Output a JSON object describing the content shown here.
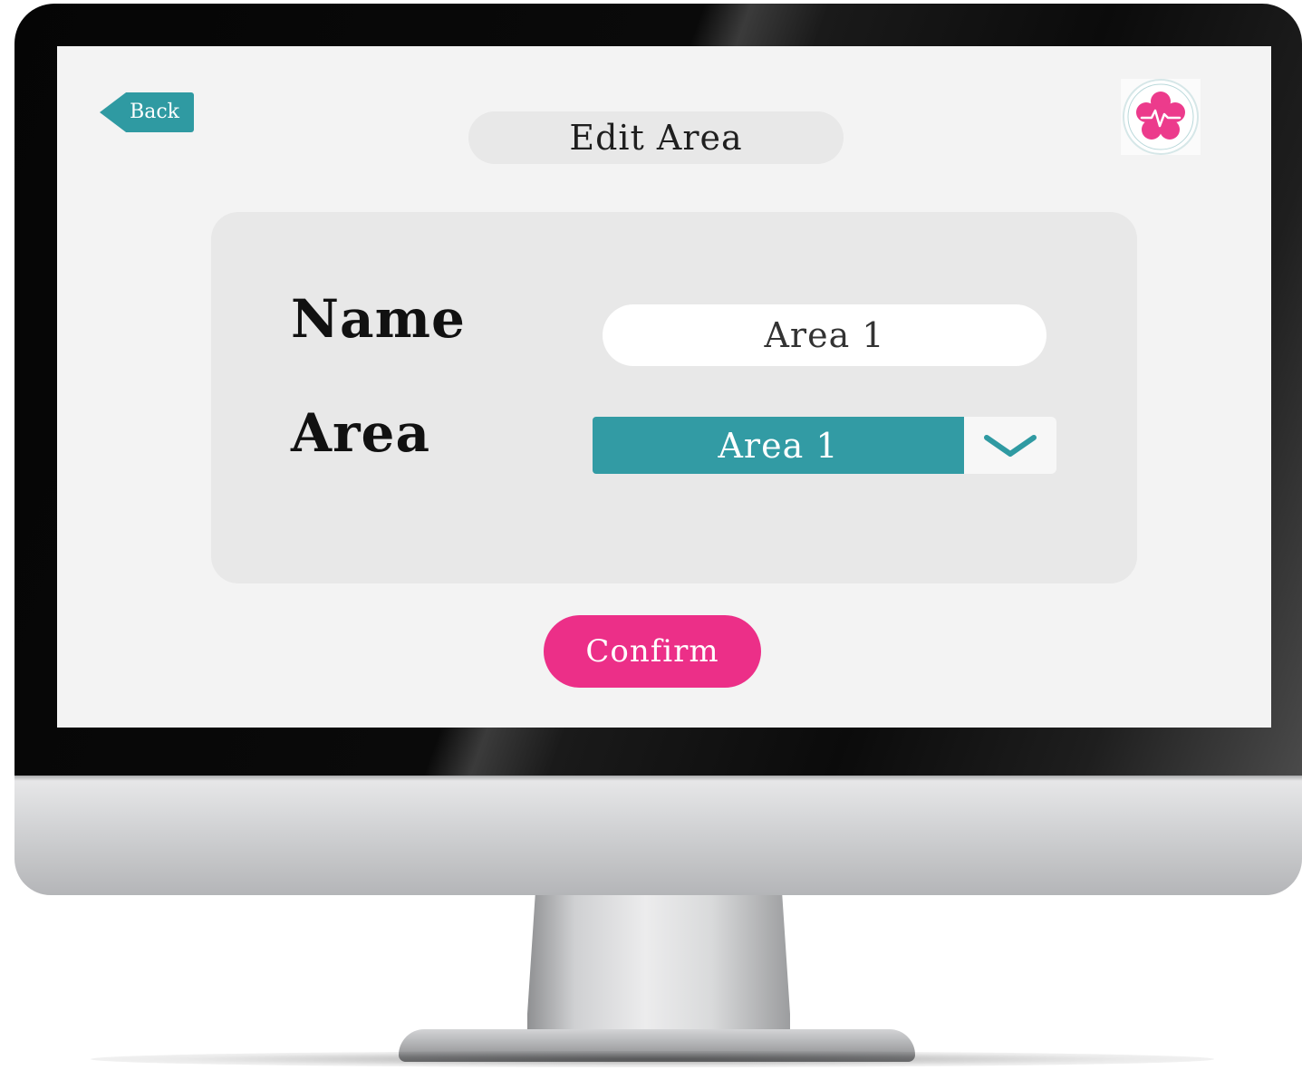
{
  "header": {
    "back_label": "Back",
    "title": "Edit Area",
    "logo_icon": "medical-star-icon"
  },
  "form": {
    "name_label": "Name",
    "name_value": "Area 1",
    "area_label": "Area",
    "area_selected": "Area 1"
  },
  "actions": {
    "confirm_label": "Confirm"
  },
  "colors": {
    "teal_accent": "#329ba4",
    "pink_accent": "#ec2f88",
    "screen_background": "#f3f3f3",
    "panel_background": "#e8e8e8"
  }
}
